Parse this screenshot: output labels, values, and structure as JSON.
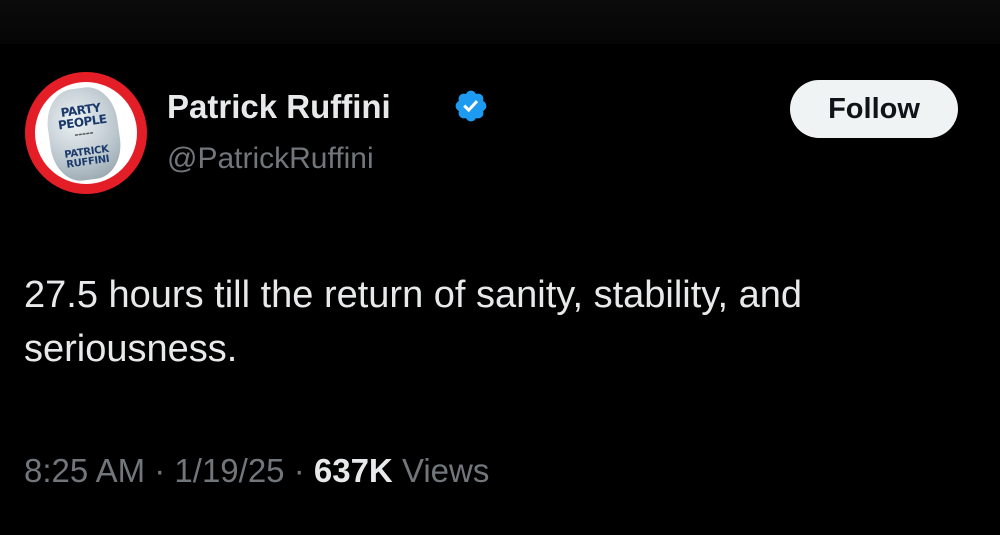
{
  "tweet": {
    "author": {
      "display_name": "Patrick Ruffini",
      "handle": "@PatrickRuffini",
      "verified": true,
      "avatar": {
        "title_line1": "PARTY",
        "title_line1_small": "OF THE",
        "title_line2": "PEOPLE",
        "author_line1": "PATRICK",
        "author_line2": "RUFFINI"
      }
    },
    "follow_label": "Follow",
    "text": "27.5 hours till the return of sanity, stability, and seriousness.",
    "time": "8:25 AM",
    "separator": "·",
    "date": "1/19/25",
    "views_count": "637K",
    "views_label": "Views"
  },
  "colors": {
    "background": "#000000",
    "primary_text": "#e7e9ea",
    "secondary_text": "#71767b",
    "verified_blue": "#1d9bf0",
    "follow_bg": "#eff3f4",
    "avatar_ring": "#e41e26"
  },
  "icons": {
    "verified": "verified-badge-icon"
  }
}
